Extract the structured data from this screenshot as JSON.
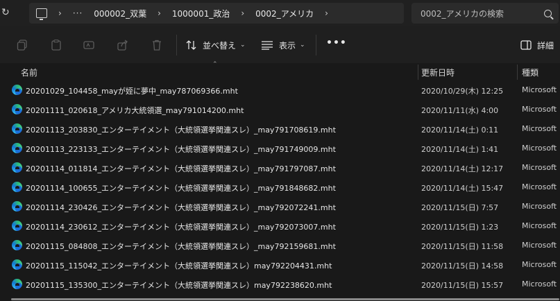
{
  "address": {
    "breadcrumbs": [
      "000002_双葉",
      "1000001_政治",
      "0002_アメリカ"
    ]
  },
  "search": {
    "placeholder": "0002_アメリカの検索"
  },
  "toolbar": {
    "sort_label": "並べ替え",
    "view_label": "表示",
    "details_label": "詳細"
  },
  "columns": {
    "name": "名前",
    "date": "更新日時",
    "type": "種類"
  },
  "files": [
    {
      "name": "20201029_104458_mayが姪に夢中_may787069366.mht",
      "date": "2020/10/29(木) 12:25",
      "type": "Microsoft"
    },
    {
      "name": "20201111_020618_アメリカ大統領選_may791014200.mht",
      "date": "2020/11/11(水) 4:00",
      "type": "Microsoft"
    },
    {
      "name": "20201113_203830_エンターテイメント（大統領選挙関連スレ）_may791708619.mht",
      "date": "2020/11/14(土) 0:11",
      "type": "Microsoft"
    },
    {
      "name": "20201113_223133_エンターテイメント（大統領選挙関連スレ）_may791749009.mht",
      "date": "2020/11/14(土) 1:41",
      "type": "Microsoft"
    },
    {
      "name": "20201114_011814_エンターテイメント（大統領選挙関連スレ）_may791797087.mht",
      "date": "2020/11/14(土) 12:17",
      "type": "Microsoft"
    },
    {
      "name": "20201114_100655_エンターテイメント（大統領選挙関連スレ）_may791848682.mht",
      "date": "2020/11/14(土) 15:47",
      "type": "Microsoft"
    },
    {
      "name": "20201114_230426_エンターテイメント（大統領選挙関連スレ）_may792072241.mht",
      "date": "2020/11/15(日) 7:57",
      "type": "Microsoft"
    },
    {
      "name": "20201114_230612_エンターテイメント（大統領選挙関連スレ）_may792073007.mht",
      "date": "2020/11/15(日) 1:23",
      "type": "Microsoft"
    },
    {
      "name": "20201115_084808_エンターテイメント（大統領選挙関連スレ）_may792159681.mht",
      "date": "2020/11/15(日) 11:58",
      "type": "Microsoft"
    },
    {
      "name": "20201115_115042_エンターテイメント（大統領選挙関連スレ）may792204431.mht",
      "date": "2020/11/15(日) 14:58",
      "type": "Microsoft"
    },
    {
      "name": "20201115_135300_エンターテイメント（大統領選挙関連スレ）may792238620.mht",
      "date": "2020/11/15(日) 15:57",
      "type": "Microsoft"
    }
  ]
}
